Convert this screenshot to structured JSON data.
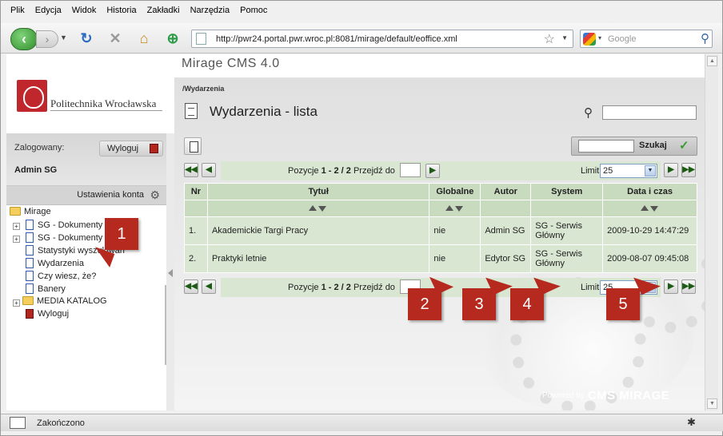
{
  "menu": [
    "Plik",
    "Edycja",
    "Widok",
    "Historia",
    "Zakładki",
    "Narzędzia",
    "Pomoc"
  ],
  "url": "http://pwr24.portal.pwr.wroc.pl:8081/mirage/default/eoffice.xml",
  "search_placeholder": "Google",
  "cms_title": "Mirage CMS 4.0",
  "logo_name": "Politechnika Wrocławska",
  "sidebar": {
    "logged_label": "Zalogowany:",
    "logout_label": "Wyloguj",
    "user_name": "Admin SG",
    "settings_label": "Ustawienia konta",
    "tree": [
      {
        "label": "Mirage"
      },
      {
        "label": "SG - Dokumenty"
      },
      {
        "label": "SG - Dokumenty"
      },
      {
        "label": "Statystyki wyszukiwań"
      },
      {
        "label": "Wydarzenia"
      },
      {
        "label": "Czy wiesz, że?"
      },
      {
        "label": "Banery"
      },
      {
        "label": "MEDIA KATALOG"
      },
      {
        "label": "Wyloguj"
      }
    ]
  },
  "main": {
    "breadcrumb": "/Wydarzenia",
    "title": "Wydarzenia - lista",
    "search_button": "Szukaj",
    "pager": {
      "pos_label": "Pozycje",
      "range": "1 - 2 / 2",
      "goto_label": "Przejdź do",
      "limit_label": "Limit",
      "limit_value": "25"
    },
    "columns": [
      "Nr",
      "Tytuł",
      "Globalne",
      "Autor",
      "System",
      "Data i czas"
    ],
    "rows": [
      [
        "1.",
        "Akademickie Targi Pracy",
        "nie",
        "Admin SG",
        "SG - Serwis Główny",
        "2009-10-29 14:47:29"
      ],
      [
        "2.",
        "Praktyki letnie",
        "nie",
        "Edytor SG",
        "SG - Serwis Główny",
        "2009-08-07 09:45:08"
      ]
    ],
    "powered_by": "Powered by",
    "powered_brand": "CMS MIRAGE"
  },
  "callouts": [
    "1",
    "2",
    "3",
    "4",
    "5"
  ],
  "status_text": "Zakończono",
  "colors": {
    "accent": "#b5291f",
    "table_header": "#c8dbbf",
    "table_row": "#d8e6d2",
    "nav_green": "#2f8d2a"
  }
}
